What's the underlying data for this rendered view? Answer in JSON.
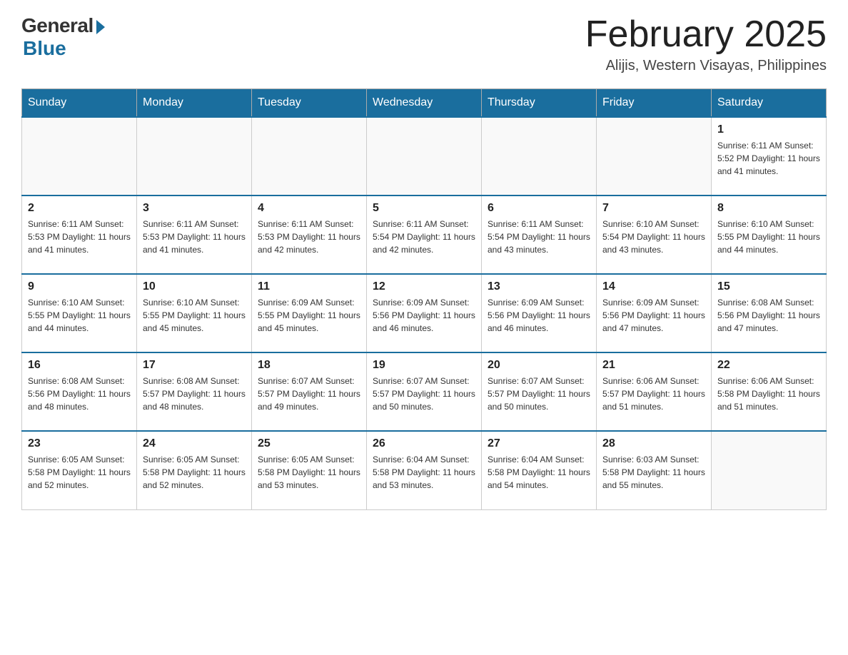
{
  "header": {
    "logo_general": "General",
    "logo_blue": "Blue",
    "month_title": "February 2025",
    "location": "Alijis, Western Visayas, Philippines"
  },
  "days_of_week": [
    "Sunday",
    "Monday",
    "Tuesday",
    "Wednesday",
    "Thursday",
    "Friday",
    "Saturday"
  ],
  "weeks": [
    [
      {
        "day": "",
        "info": ""
      },
      {
        "day": "",
        "info": ""
      },
      {
        "day": "",
        "info": ""
      },
      {
        "day": "",
        "info": ""
      },
      {
        "day": "",
        "info": ""
      },
      {
        "day": "",
        "info": ""
      },
      {
        "day": "1",
        "info": "Sunrise: 6:11 AM\nSunset: 5:52 PM\nDaylight: 11 hours\nand 41 minutes."
      }
    ],
    [
      {
        "day": "2",
        "info": "Sunrise: 6:11 AM\nSunset: 5:53 PM\nDaylight: 11 hours\nand 41 minutes."
      },
      {
        "day": "3",
        "info": "Sunrise: 6:11 AM\nSunset: 5:53 PM\nDaylight: 11 hours\nand 41 minutes."
      },
      {
        "day": "4",
        "info": "Sunrise: 6:11 AM\nSunset: 5:53 PM\nDaylight: 11 hours\nand 42 minutes."
      },
      {
        "day": "5",
        "info": "Sunrise: 6:11 AM\nSunset: 5:54 PM\nDaylight: 11 hours\nand 42 minutes."
      },
      {
        "day": "6",
        "info": "Sunrise: 6:11 AM\nSunset: 5:54 PM\nDaylight: 11 hours\nand 43 minutes."
      },
      {
        "day": "7",
        "info": "Sunrise: 6:10 AM\nSunset: 5:54 PM\nDaylight: 11 hours\nand 43 minutes."
      },
      {
        "day": "8",
        "info": "Sunrise: 6:10 AM\nSunset: 5:55 PM\nDaylight: 11 hours\nand 44 minutes."
      }
    ],
    [
      {
        "day": "9",
        "info": "Sunrise: 6:10 AM\nSunset: 5:55 PM\nDaylight: 11 hours\nand 44 minutes."
      },
      {
        "day": "10",
        "info": "Sunrise: 6:10 AM\nSunset: 5:55 PM\nDaylight: 11 hours\nand 45 minutes."
      },
      {
        "day": "11",
        "info": "Sunrise: 6:09 AM\nSunset: 5:55 PM\nDaylight: 11 hours\nand 45 minutes."
      },
      {
        "day": "12",
        "info": "Sunrise: 6:09 AM\nSunset: 5:56 PM\nDaylight: 11 hours\nand 46 minutes."
      },
      {
        "day": "13",
        "info": "Sunrise: 6:09 AM\nSunset: 5:56 PM\nDaylight: 11 hours\nand 46 minutes."
      },
      {
        "day": "14",
        "info": "Sunrise: 6:09 AM\nSunset: 5:56 PM\nDaylight: 11 hours\nand 47 minutes."
      },
      {
        "day": "15",
        "info": "Sunrise: 6:08 AM\nSunset: 5:56 PM\nDaylight: 11 hours\nand 47 minutes."
      }
    ],
    [
      {
        "day": "16",
        "info": "Sunrise: 6:08 AM\nSunset: 5:56 PM\nDaylight: 11 hours\nand 48 minutes."
      },
      {
        "day": "17",
        "info": "Sunrise: 6:08 AM\nSunset: 5:57 PM\nDaylight: 11 hours\nand 48 minutes."
      },
      {
        "day": "18",
        "info": "Sunrise: 6:07 AM\nSunset: 5:57 PM\nDaylight: 11 hours\nand 49 minutes."
      },
      {
        "day": "19",
        "info": "Sunrise: 6:07 AM\nSunset: 5:57 PM\nDaylight: 11 hours\nand 50 minutes."
      },
      {
        "day": "20",
        "info": "Sunrise: 6:07 AM\nSunset: 5:57 PM\nDaylight: 11 hours\nand 50 minutes."
      },
      {
        "day": "21",
        "info": "Sunrise: 6:06 AM\nSunset: 5:57 PM\nDaylight: 11 hours\nand 51 minutes."
      },
      {
        "day": "22",
        "info": "Sunrise: 6:06 AM\nSunset: 5:58 PM\nDaylight: 11 hours\nand 51 minutes."
      }
    ],
    [
      {
        "day": "23",
        "info": "Sunrise: 6:05 AM\nSunset: 5:58 PM\nDaylight: 11 hours\nand 52 minutes."
      },
      {
        "day": "24",
        "info": "Sunrise: 6:05 AM\nSunset: 5:58 PM\nDaylight: 11 hours\nand 52 minutes."
      },
      {
        "day": "25",
        "info": "Sunrise: 6:05 AM\nSunset: 5:58 PM\nDaylight: 11 hours\nand 53 minutes."
      },
      {
        "day": "26",
        "info": "Sunrise: 6:04 AM\nSunset: 5:58 PM\nDaylight: 11 hours\nand 53 minutes."
      },
      {
        "day": "27",
        "info": "Sunrise: 6:04 AM\nSunset: 5:58 PM\nDaylight: 11 hours\nand 54 minutes."
      },
      {
        "day": "28",
        "info": "Sunrise: 6:03 AM\nSunset: 5:58 PM\nDaylight: 11 hours\nand 55 minutes."
      },
      {
        "day": "",
        "info": ""
      }
    ]
  ]
}
